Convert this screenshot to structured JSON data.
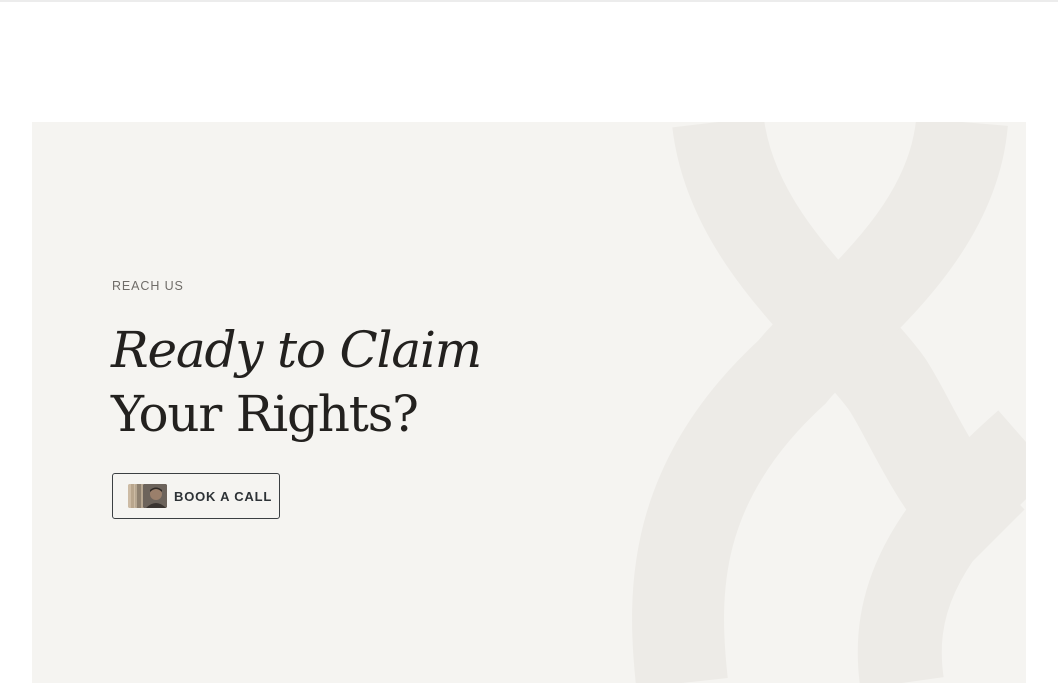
{
  "section": {
    "eyebrow": "REACH US",
    "heading_line1": "Ready to Claim",
    "heading_line2": "Your Rights?"
  },
  "cta": {
    "label": "BOOK A CALL",
    "avatars": [
      "avatar",
      "avatar",
      "avatar"
    ]
  },
  "colors": {
    "card_background": "#f5f4f1",
    "heading": "#23211f",
    "eyebrow": "#6f6c68",
    "button_border": "#3b3f42",
    "decoration": "#edebe7"
  },
  "icons": {
    "decoration": "ampersand-shape-icon"
  }
}
